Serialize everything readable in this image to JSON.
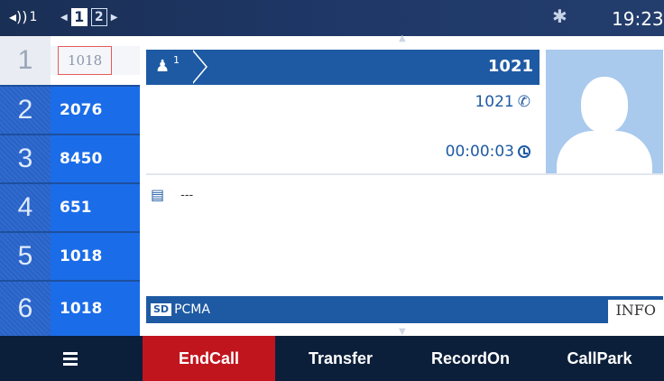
{
  "status_bar": {
    "volume_icon": "speaker-icon",
    "volume_level": "1",
    "pages": [
      "1",
      "2"
    ],
    "active_page": "1",
    "bluetooth_icon": "bluetooth-icon",
    "time": "19:23"
  },
  "lines": [
    {
      "index": "1",
      "label": "1018",
      "active": true
    },
    {
      "index": "2",
      "label": "2076",
      "active": false
    },
    {
      "index": "3",
      "label": "8450",
      "active": false
    },
    {
      "index": "4",
      "label": "651",
      "active": false
    },
    {
      "index": "5",
      "label": "1018",
      "active": false
    },
    {
      "index": "6",
      "label": "1018",
      "active": false
    }
  ],
  "call": {
    "slot_number": "1",
    "remote_name": "1021",
    "remote_number": "1021",
    "duration": "00:00:03",
    "note": "---"
  },
  "codec_bar": {
    "quality_badge": "SD",
    "codec": "PCMA",
    "info_label": "INFO"
  },
  "softkeys": {
    "menu_icon": "menu-icon",
    "end_call": "EndCall",
    "transfer": "Transfer",
    "record_on": "RecordOn",
    "call_park": "CallPark"
  },
  "colors": {
    "status_bar": "#1a2f55",
    "accent_blue": "#1e5aa3",
    "line_key_blue": "#1b6ce8",
    "end_call_red": "#c1151e",
    "softkey_bar": "#0c1f3a"
  }
}
